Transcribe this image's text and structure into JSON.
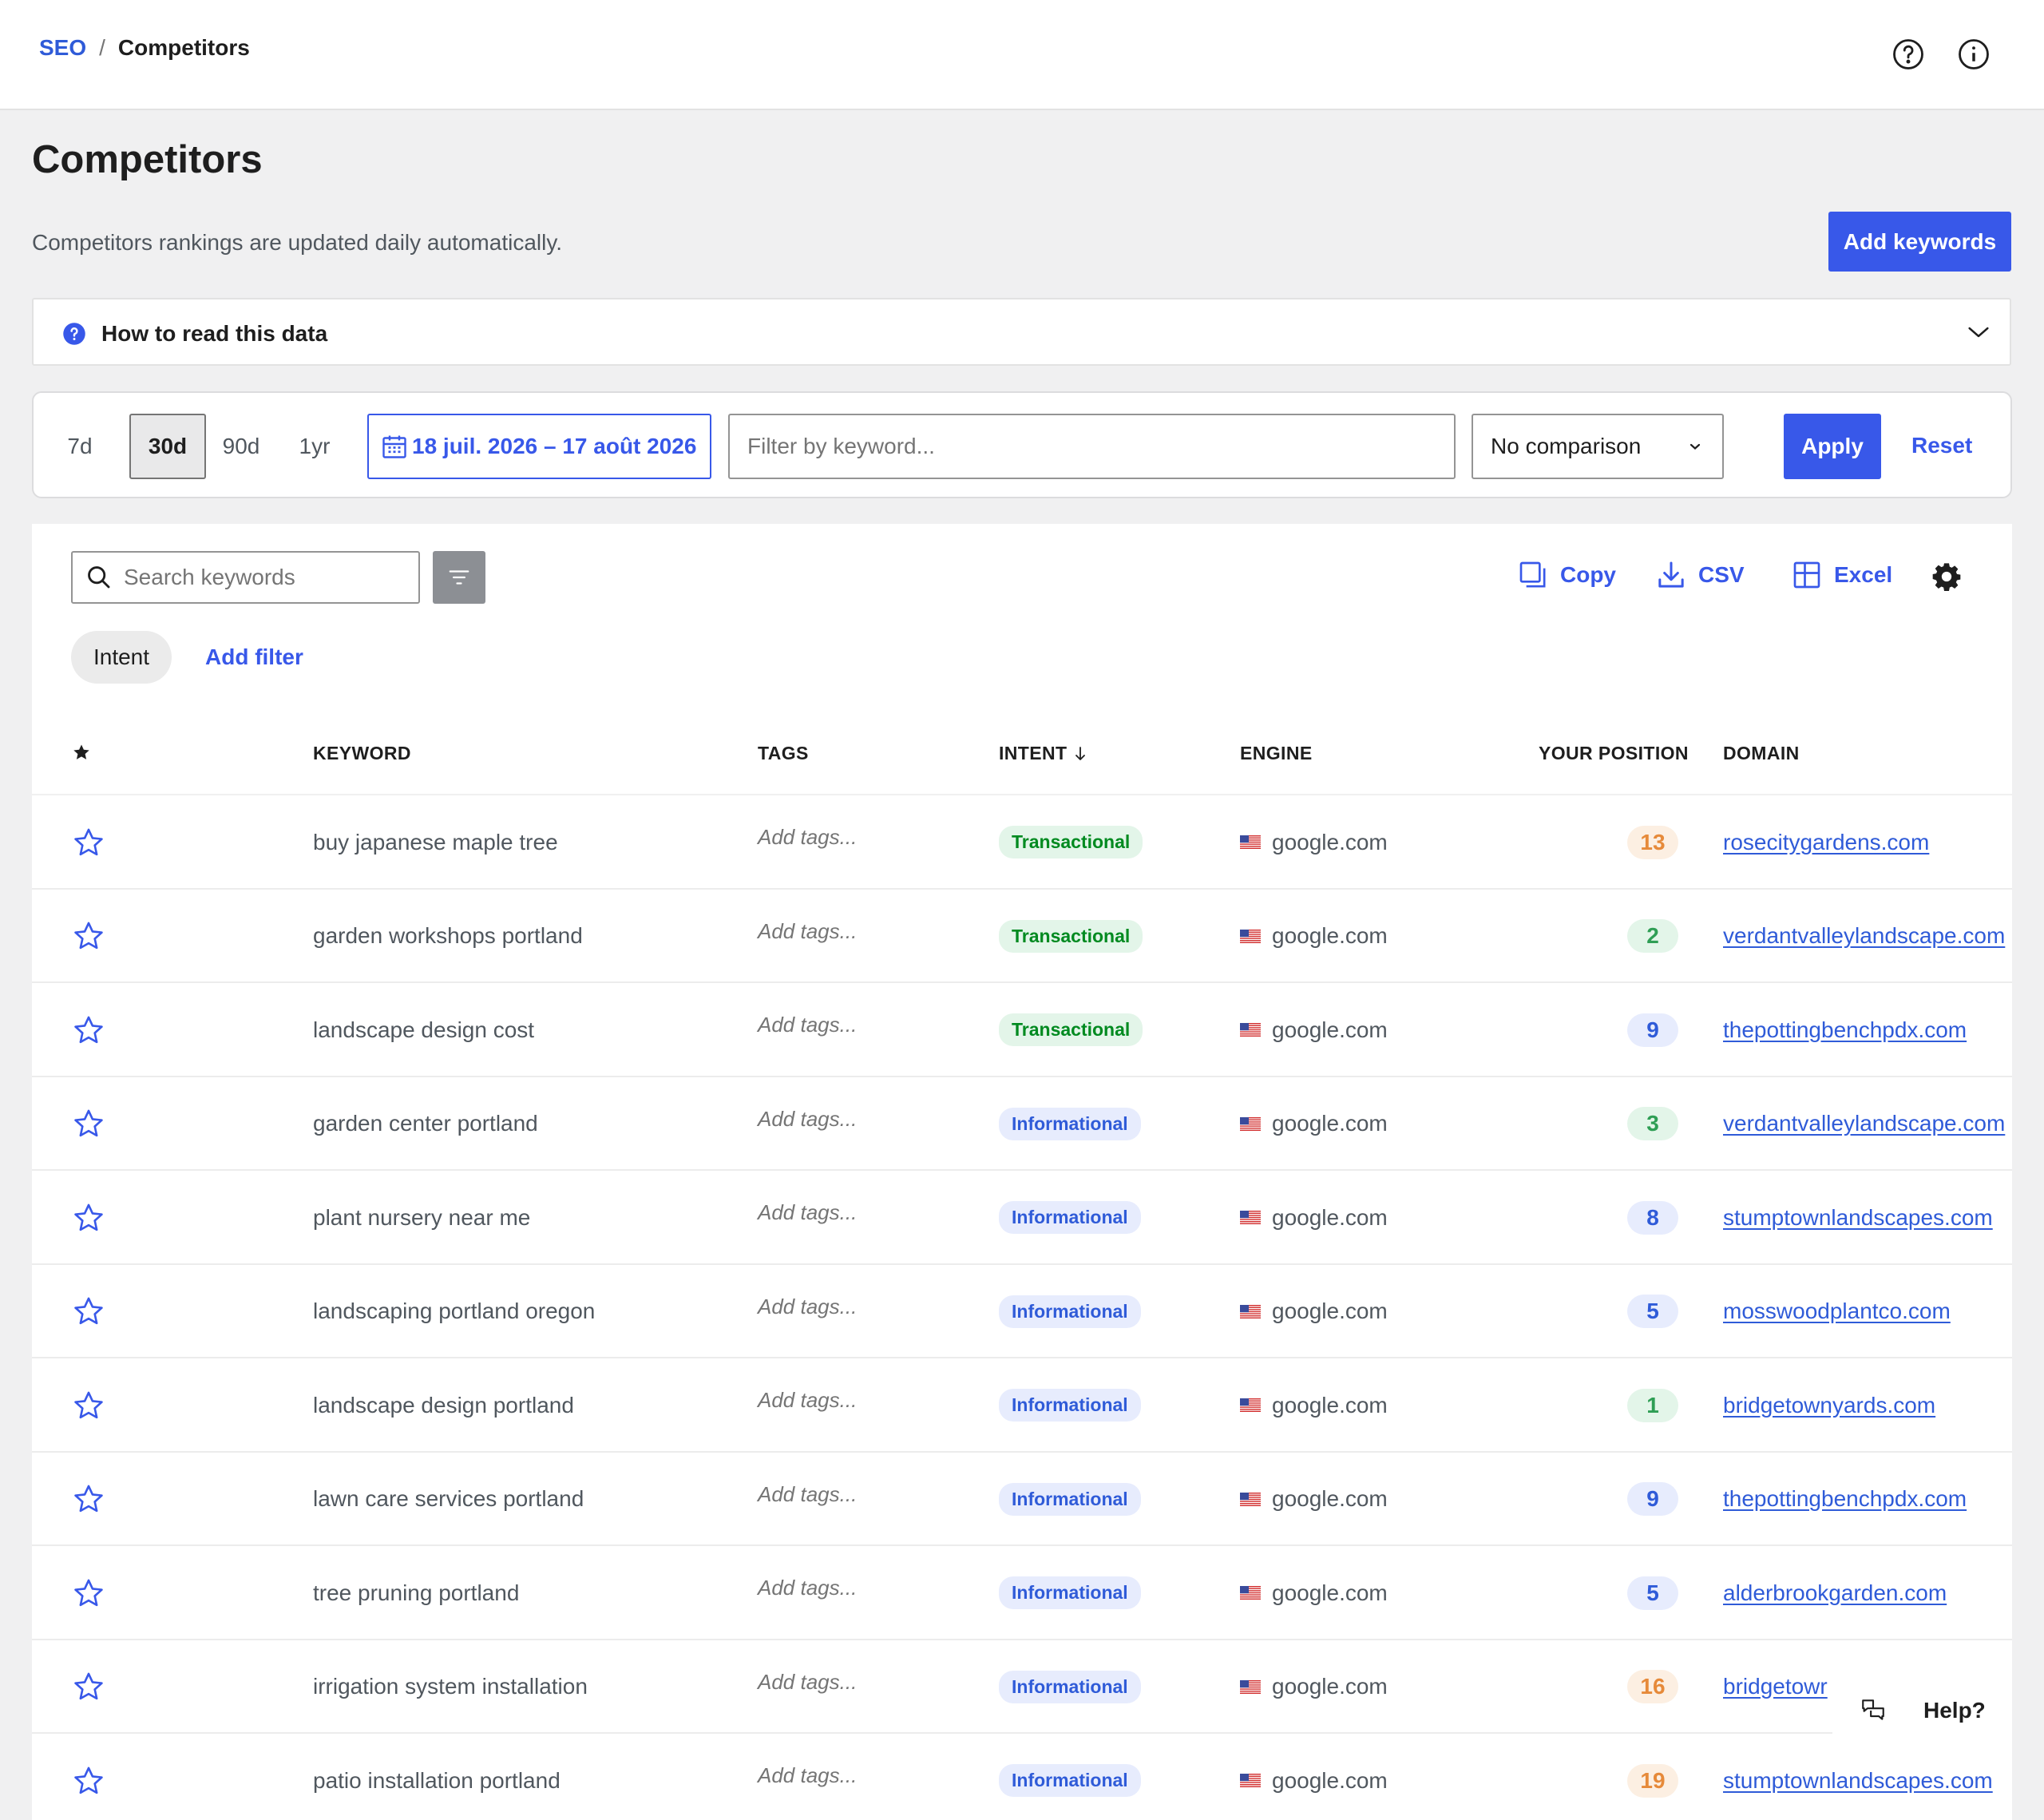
{
  "breadcrumb": {
    "root": "SEO",
    "separator": "/",
    "current": "Competitors"
  },
  "header_icons": [
    "help-circle-icon",
    "info-icon"
  ],
  "page": {
    "title": "Competitors",
    "subtitle": "Competitors rankings are updated daily automatically.",
    "add_keywords_label": "Add keywords"
  },
  "accordion": {
    "title": "How to read this data",
    "expanded": false
  },
  "filters": {
    "periods": [
      "7d",
      "30d",
      "90d",
      "1yr"
    ],
    "active_period": "30d",
    "date_range": "18 juil. 2026 – 17 août 2026",
    "keyword_placeholder": "Filter by keyword...",
    "comparison": "No comparison",
    "apply_label": "Apply",
    "reset_label": "Reset"
  },
  "toolbar": {
    "search_placeholder": "Search keywords",
    "copy_label": "Copy",
    "csv_label": "CSV",
    "excel_label": "Excel",
    "intent_chip": "Intent",
    "add_filter_label": "Add filter"
  },
  "table": {
    "headers": {
      "keyword": "KEYWORD",
      "tags": "TAGS",
      "intent": "INTENT",
      "engine": "ENGINE",
      "position": "YOUR POSITION",
      "domain": "DOMAIN"
    },
    "sort_column": "intent",
    "tags_placeholder": "Add tags...",
    "rows": [
      {
        "keyword": "buy japanese maple tree",
        "intent": "Transactional",
        "engine": "google.com",
        "position": "13",
        "domain": "rosecitygardens.com"
      },
      {
        "keyword": "garden workshops portland",
        "intent": "Transactional",
        "engine": "google.com",
        "position": "2",
        "domain": "verdantvalleylandscape.com"
      },
      {
        "keyword": "landscape design cost",
        "intent": "Transactional",
        "engine": "google.com",
        "position": "9",
        "domain": "thepottingbenchpdx.com"
      },
      {
        "keyword": "garden center portland",
        "intent": "Informational",
        "engine": "google.com",
        "position": "3",
        "domain": "verdantvalleylandscape.com"
      },
      {
        "keyword": "plant nursery near me",
        "intent": "Informational",
        "engine": "google.com",
        "position": "8",
        "domain": "stumptownlandscapes.com"
      },
      {
        "keyword": "landscaping portland oregon",
        "intent": "Informational",
        "engine": "google.com",
        "position": "5",
        "domain": "mosswoodplantco.com"
      },
      {
        "keyword": "landscape design portland",
        "intent": "Informational",
        "engine": "google.com",
        "position": "1",
        "domain": "bridgetownyards.com"
      },
      {
        "keyword": "lawn care services portland",
        "intent": "Informational",
        "engine": "google.com",
        "position": "9",
        "domain": "thepottingbenchpdx.com"
      },
      {
        "keyword": "tree pruning portland",
        "intent": "Informational",
        "engine": "google.com",
        "position": "5",
        "domain": "alderbrookgarden.com"
      },
      {
        "keyword": "irrigation system installation",
        "intent": "Informational",
        "engine": "google.com",
        "position": "16",
        "domain": "bridgetowr"
      },
      {
        "keyword": "patio installation portland",
        "intent": "Informational",
        "engine": "google.com",
        "position": "19",
        "domain": "stumptownlandscapes.com"
      }
    ]
  },
  "help_widget": {
    "label": "Help?"
  },
  "colors": {
    "accent": "#3858e9",
    "transactional": "#008a20",
    "informational": "#2f5bd8",
    "position_high": "#e68a3a",
    "position_top": "#2f9e55"
  }
}
